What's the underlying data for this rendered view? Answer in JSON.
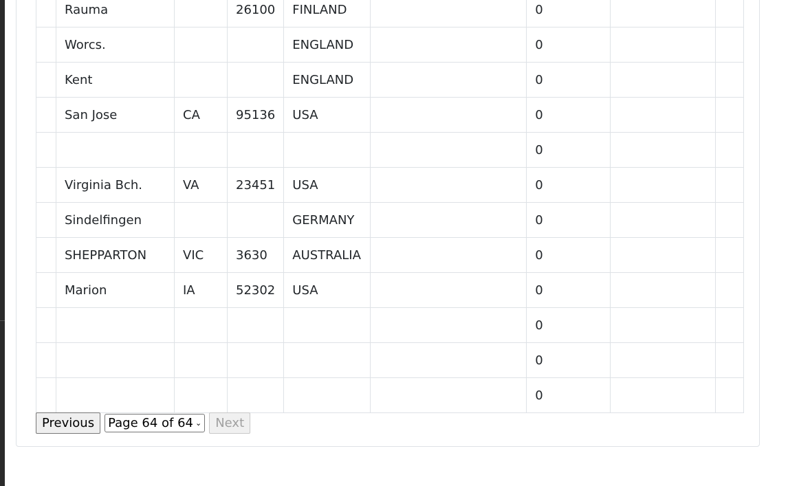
{
  "table": {
    "rows": [
      {
        "city": "Rauma",
        "state": "",
        "zip": "26100",
        "country": "FINLAND",
        "extra": "",
        "value": "0",
        "col7": "",
        "col8": ""
      },
      {
        "city": "Worcs.",
        "state": "",
        "zip": "",
        "country": "ENGLAND",
        "extra": "",
        "value": "0",
        "col7": "",
        "col8": ""
      },
      {
        "city": "Kent",
        "state": "",
        "zip": "",
        "country": "ENGLAND",
        "extra": "",
        "value": "0",
        "col7": "",
        "col8": ""
      },
      {
        "city": "San Jose",
        "state": "CA",
        "zip": "95136",
        "country": "USA",
        "extra": "",
        "value": "0",
        "col7": "",
        "col8": ""
      },
      {
        "city": "",
        "state": "",
        "zip": "",
        "country": "",
        "extra": "",
        "value": "0",
        "col7": "",
        "col8": ""
      },
      {
        "city": "Virginia Bch.",
        "state": "VA",
        "zip": "23451",
        "country": "USA",
        "extra": "",
        "value": "0",
        "col7": "",
        "col8": ""
      },
      {
        "city": "Sindelfingen",
        "state": "",
        "zip": "",
        "country": "GERMANY",
        "extra": "",
        "value": "0",
        "col7": "",
        "col8": ""
      },
      {
        "city": "SHEPPARTON",
        "state": "VIC",
        "zip": "3630",
        "country": "AUSTRALIA",
        "extra": "",
        "value": "0",
        "col7": "",
        "col8": ""
      },
      {
        "city": "Marion",
        "state": "IA",
        "zip": "52302",
        "country": "USA",
        "extra": "",
        "value": "0",
        "col7": "",
        "col8": ""
      },
      {
        "city": "",
        "state": "",
        "zip": "",
        "country": "",
        "extra": "",
        "value": "0",
        "col7": "",
        "col8": ""
      },
      {
        "city": "",
        "state": "",
        "zip": "",
        "country": "",
        "extra": "",
        "value": "0",
        "col7": "",
        "col8": ""
      },
      {
        "city": "",
        "state": "",
        "zip": "",
        "country": "",
        "extra": "",
        "value": "0",
        "col7": "",
        "col8": ""
      }
    ]
  },
  "pager": {
    "previous_label": "Previous",
    "page_select_value": "Page 64 of 64",
    "next_label": "Next"
  }
}
